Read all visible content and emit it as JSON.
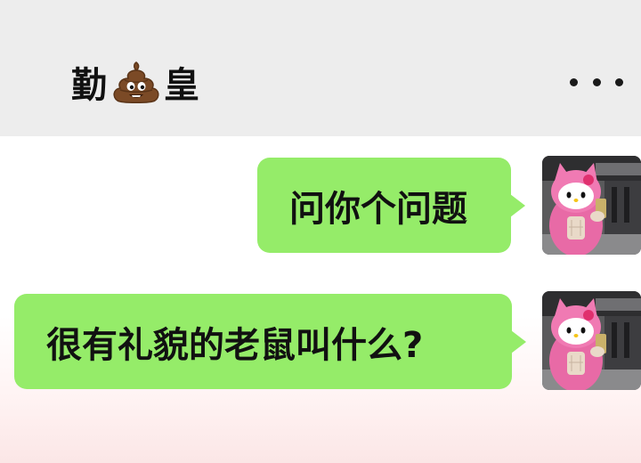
{
  "header": {
    "title_part1": "勤",
    "title_emoji": "poo-emoji-icon",
    "title_part2": "皇",
    "more_icon": "more-dots-icon"
  },
  "messages": [
    {
      "sender": "me",
      "text": "问你个问题",
      "avatar_icon": "hello-kitty-avatar"
    },
    {
      "sender": "me",
      "text": "很有礼貌的老鼠叫什么?",
      "avatar_icon": "hello-kitty-avatar"
    }
  ],
  "colors": {
    "header_bg": "#ededed",
    "bubble_green": "#95ec69",
    "text": "#111111"
  }
}
